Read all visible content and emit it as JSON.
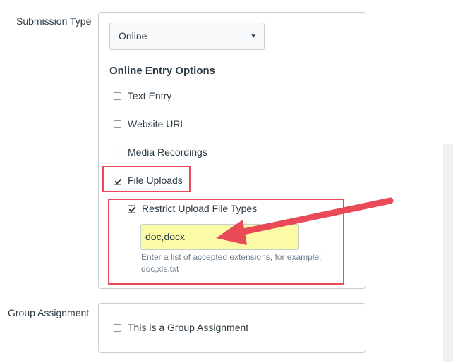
{
  "submission": {
    "label": "Submission Type",
    "selected": "Online",
    "online_heading": "Online Entry Options",
    "options": {
      "text_entry": "Text Entry",
      "website_url": "Website URL",
      "media_recordings": "Media Recordings",
      "file_uploads": "File Uploads"
    },
    "restrict_label": "Restrict Upload File Types",
    "extensions_value": "doc,docx",
    "extensions_hint": "Enter a list of accepted extensions, for example: doc,xls,txt"
  },
  "group": {
    "label": "Group Assignment",
    "checkbox_label": "This is a Group Assignment"
  },
  "colors": {
    "annotation": "#e84b57",
    "input_highlight": "#fbfba6"
  }
}
